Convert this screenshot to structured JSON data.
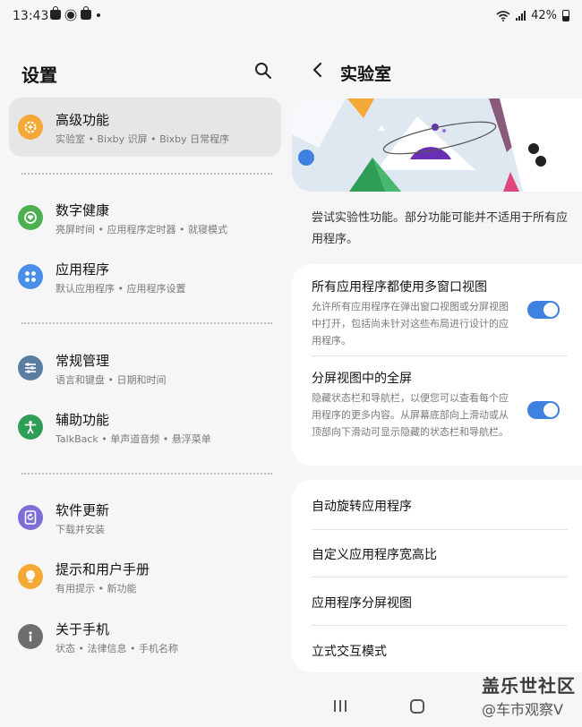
{
  "status_bar": {
    "time": "13:43",
    "battery": "42%",
    "notification_icons": [
      "shopping-bag-icon",
      "sun-icon",
      "shopping-bag-icon",
      "dot-icon"
    ]
  },
  "settings": {
    "title": "设置",
    "items": [
      {
        "label": "高级功能",
        "subtitle": "实验室 • Bixby 识屏 • Bixby 日常程序",
        "icon": "gear-plus-icon",
        "color": "#f4a836",
        "active": true
      },
      {
        "label": "数字健康",
        "subtitle": "亮屏时间 • 应用程序定时器 • 就寝模式",
        "icon": "heart-ring-icon",
        "color": "#4caf50"
      },
      {
        "label": "应用程序",
        "subtitle": "默认应用程序 • 应用程序设置",
        "icon": "app-grid-icon",
        "color": "#4a8fe7"
      },
      {
        "label": "常规管理",
        "subtitle": "语言和键盘 • 日期和时间",
        "icon": "sliders-icon",
        "color": "#5a7ea0"
      },
      {
        "label": "辅助功能",
        "subtitle": "TalkBack • 单声道音频 • 悬浮菜单",
        "icon": "accessibility-icon",
        "color": "#2e9e56"
      },
      {
        "label": "软件更新",
        "subtitle": "下载并安装",
        "icon": "update-icon",
        "color": "#7b6fd6"
      },
      {
        "label": "提示和用户手册",
        "subtitle": "有用提示 • 新功能",
        "icon": "lightbulb-icon",
        "color": "#f4a836"
      },
      {
        "label": "关于手机",
        "subtitle": "状态 • 法律信息 • 手机名称",
        "icon": "info-icon",
        "color": "#6e6e6e"
      }
    ]
  },
  "labs": {
    "title": "实验室",
    "description": "尝试实验性功能。部分功能可能并不适用于所有应用程序。",
    "toggles": [
      {
        "label": "所有应用程序都使用多窗口视图",
        "subtitle": "允许所有应用程序在弹出窗口视图或分屏视图中打开，包括尚未针对这些布局进行设计的应用程序。",
        "enabled": true
      },
      {
        "label": "分屏视图中的全屏",
        "subtitle": "隐藏状态栏和导航栏，以便您可以查看每个应用程序的更多内容。从屏幕底部向上滑动或从顶部向下滑动可显示隐藏的状态栏和导航栏。",
        "enabled": true
      }
    ],
    "links": [
      "自动旋转应用程序",
      "自定义应用程序宽高比",
      "应用程序分屏视图",
      "立式交互模式"
    ]
  },
  "watermark": {
    "line1": "盖乐世社区",
    "line2": "@车市观察V"
  },
  "colors": {
    "accent": "#3e81e0",
    "background": "#f6f6f6",
    "card": "#ffffff"
  }
}
